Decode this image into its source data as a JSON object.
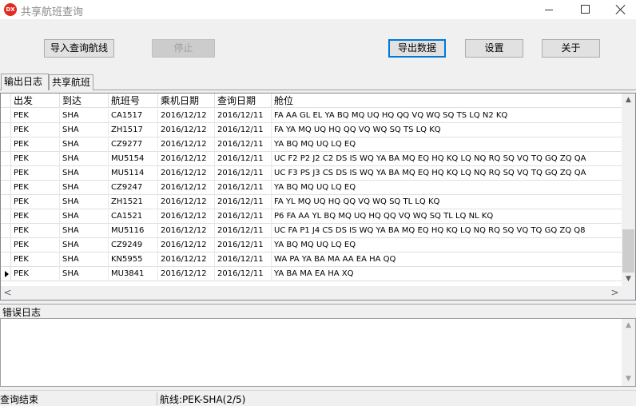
{
  "window": {
    "title": "共享航班查询",
    "icon_text": "DX",
    "minimize_symbol": "─",
    "maximize_symbol": "☐",
    "close_symbol": "✕"
  },
  "toolbar": {
    "import_label": "导入查询航线",
    "stop_label": "停止",
    "export_label": "导出数据",
    "settings_label": "设置",
    "about_label": "关于"
  },
  "tabs": [
    {
      "label": "输出日志",
      "active": true
    },
    {
      "label": "共享航班",
      "active": false
    }
  ],
  "grid": {
    "columns": [
      "出发",
      "到达",
      "航班号",
      "乘机日期",
      "查询日期",
      "舱位"
    ],
    "rows": [
      [
        "PEK",
        "SHA",
        "CA1517",
        "2016/12/12",
        "2016/12/11",
        "FA AA GL EL YA BQ MQ UQ HQ QQ VQ WQ SQ TS LQ N2 KQ"
      ],
      [
        "PEK",
        "SHA",
        "ZH1517",
        "2016/12/12",
        "2016/12/11",
        "FA YA MQ UQ HQ QQ VQ WQ SQ TS LQ KQ"
      ],
      [
        "PEK",
        "SHA",
        "CZ9277",
        "2016/12/12",
        "2016/12/11",
        "YA BQ MQ UQ LQ EQ"
      ],
      [
        "PEK",
        "SHA",
        "MU5154",
        "2016/12/12",
        "2016/12/11",
        "UC F2 P2 J2 C2 DS IS WQ YA BA MQ EQ HQ KQ LQ NQ RQ SQ VQ TQ GQ ZQ QA"
      ],
      [
        "PEK",
        "SHA",
        "MU5114",
        "2016/12/12",
        "2016/12/11",
        "UC F3 PS J3 CS DS IS WQ YA BA MQ EQ HQ KQ LQ NQ RQ SQ VQ TQ GQ ZQ QA"
      ],
      [
        "PEK",
        "SHA",
        "CZ9247",
        "2016/12/12",
        "2016/12/11",
        "YA BQ MQ UQ LQ EQ"
      ],
      [
        "PEK",
        "SHA",
        "ZH1521",
        "2016/12/12",
        "2016/12/11",
        "FA YL MQ UQ HQ QQ VQ WQ SQ TL LQ KQ"
      ],
      [
        "PEK",
        "SHA",
        "CA1521",
        "2016/12/12",
        "2016/12/11",
        "P6 FA AA YL BQ MQ UQ HQ QQ VQ WQ SQ TL LQ NL KQ"
      ],
      [
        "PEK",
        "SHA",
        "MU5116",
        "2016/12/12",
        "2016/12/11",
        "UC FA P1 J4 CS DS IS WQ YA BA MQ EQ HQ KQ LQ NQ RQ SQ VQ TQ GQ ZQ Q8"
      ],
      [
        "PEK",
        "SHA",
        "CZ9249",
        "2016/12/12",
        "2016/12/11",
        "YA BQ MQ UQ LQ EQ"
      ],
      [
        "PEK",
        "SHA",
        "KN5955",
        "2016/12/12",
        "2016/12/11",
        "WA PA YA BA MA AA EA HA QQ"
      ],
      [
        "PEK",
        "SHA",
        "MU3841",
        "2016/12/12",
        "2016/12/11",
        "YA BA MA EA HA XQ"
      ]
    ],
    "current_row_index": 11,
    "scroll_up_symbol": "▲",
    "scroll_down_symbol": "▼",
    "scroll_left_symbol": "<",
    "scroll_right_symbol": ">"
  },
  "error_log": {
    "label": "错误日志",
    "content": ""
  },
  "statusbar": {
    "status": "查询结束",
    "route": "航线:PEK-SHA(2/5)"
  }
}
